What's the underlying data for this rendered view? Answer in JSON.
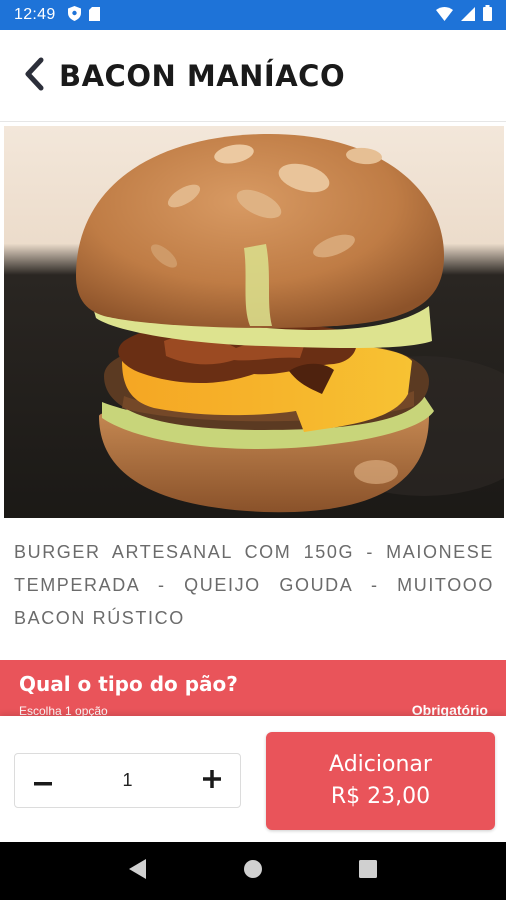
{
  "status_bar": {
    "time": "12:49",
    "left_icons": [
      "shield-icon",
      "sim-card-icon"
    ],
    "right_icons": [
      "wifi-icon",
      "signal-icon",
      "battery-icon"
    ]
  },
  "header": {
    "back_icon": "chevron-left-icon",
    "title": "BACON MANÍACO"
  },
  "product": {
    "image": "burger-photo",
    "description": "BURGER ARTESANAL COM 150G - MAIONESE TEMPERADA - QUEIJO GOUDA - MUITOOO BACON RÚSTICO"
  },
  "option_group": {
    "title": "Qual o tipo do pão?",
    "subtitle": "Escolha 1 opção",
    "required_label": "Obrigatório"
  },
  "order": {
    "quantity": "1",
    "decrement_icon": "minus-icon",
    "increment_icon": "plus-icon",
    "add_label": "Adicionar",
    "price": "R$ 23,00"
  },
  "nav_bar": {
    "icons": [
      "back-triangle-icon",
      "home-circle-icon",
      "recents-square-icon"
    ]
  },
  "colors": {
    "status_bar": "#1e73d8",
    "accent": "#e9545a",
    "text_primary": "#1a1a1a",
    "text_muted": "#6b6b6b"
  }
}
